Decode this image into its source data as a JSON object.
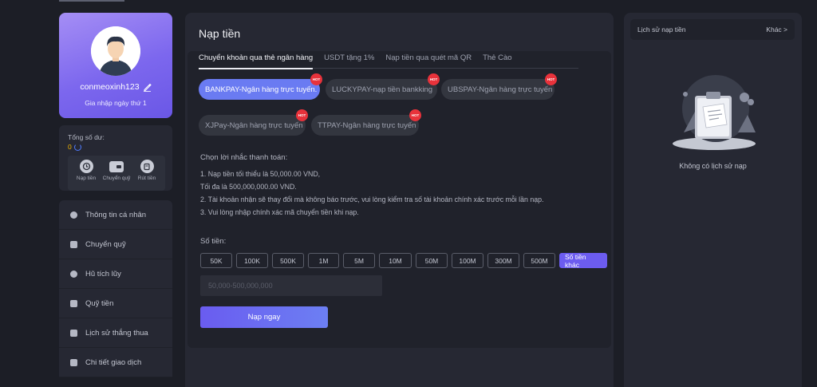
{
  "profile": {
    "username": "conmeoxinh123",
    "joined": "Gia nhập ngày thứ 1"
  },
  "balance": {
    "label": "Tổng số dư:",
    "value": "0"
  },
  "quick_actions": [
    {
      "label": "Nạp tiền",
      "icon": "deposit-icon"
    },
    {
      "label": "Chuyển quỹ",
      "icon": "wallet-icon"
    },
    {
      "label": "Rút tiền",
      "icon": "withdraw-icon"
    }
  ],
  "menu": [
    {
      "label": "Thông tin cá nhân",
      "icon": "user-icon"
    },
    {
      "label": "Chuyển quỹ",
      "icon": "wallet-icon"
    },
    {
      "label": "Hũ tích lũy",
      "icon": "savings-icon"
    },
    {
      "label": "Quỹ tiền",
      "icon": "fund-icon"
    },
    {
      "label": "Lịch sử thắng thua",
      "icon": "history-icon"
    },
    {
      "label": "Chi tiết giao dịch",
      "icon": "transaction-icon"
    }
  ],
  "main": {
    "title": "Nạp tiền",
    "tabs": [
      {
        "label": "Chuyển khoản qua thẻ ngân hàng",
        "active": true
      },
      {
        "label": "USDT tặng 1%",
        "active": false
      },
      {
        "label": "Nạp tiền qua quét mã QR",
        "active": false
      },
      {
        "label": "Thẻ Cào",
        "active": false
      }
    ],
    "gateways": [
      {
        "label": "BANKPAY-Ngân hàng trực tuyến.",
        "hot": "HOT",
        "active": true
      },
      {
        "label": "LUCKYPAY-nạp tiền bankking",
        "hot": "HOT",
        "active": false
      },
      {
        "label": "UBSPAY-Ngân hàng trực tuyến",
        "hot": "HOT",
        "active": false
      },
      {
        "label": "XJPay-Ngân hàng trực tuyến",
        "hot": "HOT",
        "active": false
      },
      {
        "label": "TTPAY-Ngân hàng trực tuyến",
        "hot": "HOT",
        "active": false
      }
    ],
    "reminder_title": "Chọn lời nhắc thanh toán:",
    "reminders": [
      "1. Nạp tiền tối thiểu là 50,000.00 VND,",
      "Tối đa là 500,000,000.00 VND.",
      "2. Tài khoản nhận sẽ thay đổi mà không báo trước, vui lòng kiểm tra số tài khoản chính xác trước mỗi lần nạp.",
      "3. Vui lòng nhập chính xác mã chuyển tiền khi nạp."
    ],
    "amount_label": "Số tiền:",
    "amount_options": [
      "50K",
      "100K",
      "500K",
      "1M",
      "5M",
      "10M",
      "50M",
      "100M",
      "300M",
      "500M",
      "Số tiền khác"
    ],
    "amount_selected": "Số tiền khác",
    "amount_placeholder": "50,000-500,000,000",
    "submit_label": "Nạp ngay"
  },
  "history": {
    "title": "Lịch sử nạp tiền",
    "more": "Khác >",
    "empty": "Không có lịch sử nạp"
  },
  "colors": {
    "accent": "#6c5cf0",
    "gateway_active": "#6a7bf2",
    "hot": "#e8323b",
    "balance": "#f0b400"
  }
}
